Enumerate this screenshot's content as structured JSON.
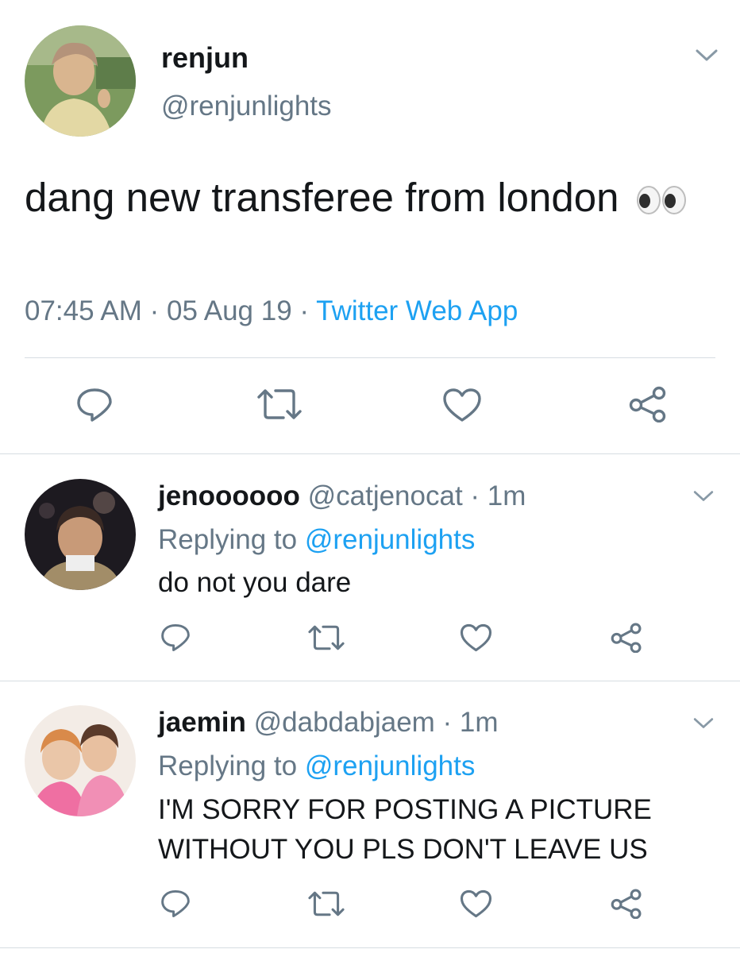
{
  "main_tweet": {
    "name": "renjun",
    "handle": "@renjunlights",
    "text": "dang new transferee from london",
    "emoji": "👀",
    "time": "07:45 AM",
    "dot1": " · ",
    "date": "05 Aug 19",
    "dot2": " · ",
    "source": "Twitter Web App"
  },
  "replies": [
    {
      "name": "jenoooooo",
      "handle": "@catjenocat",
      "separator": " · ",
      "time": "1m",
      "replying_prefix": "Replying to ",
      "replying_to": "@renjunlights",
      "text": "do not you dare"
    },
    {
      "name": "jaemin",
      "handle": "@dabdabjaem",
      "separator": " · ",
      "time": "1m",
      "replying_prefix": "Replying to ",
      "replying_to": "@renjunlights",
      "text": "I'M SORRY FOR POSTING A PICTURE WITHOUT YOU PLS DON'T LEAVE US"
    }
  ],
  "icons": {
    "reply": "reply-icon",
    "retweet": "retweet-icon",
    "like": "heart-icon",
    "share": "share-icon",
    "more": "chevron-down-icon"
  },
  "colors": {
    "text": "#14171a",
    "muted": "#657786",
    "link": "#1da1f2",
    "divider": "#d6dde2"
  }
}
